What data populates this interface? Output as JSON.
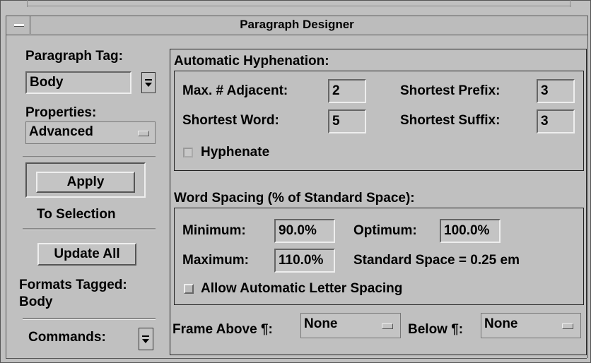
{
  "window": {
    "title": "Paragraph Designer"
  },
  "left_panel": {
    "paragraph_tag_label": "Paragraph Tag:",
    "paragraph_tag_value": "Body",
    "properties_label": "Properties:",
    "properties_value": "Advanced",
    "apply_label": "Apply",
    "to_selection_label": "To Selection",
    "update_all_label": "Update All",
    "formats_tagged_label": "Formats Tagged:",
    "formats_tagged_value": "Body",
    "commands_label": "Commands:"
  },
  "hyphenation": {
    "section_title": "Automatic Hyphenation:",
    "max_adjacent_label": "Max. # Adjacent:",
    "max_adjacent_value": "2",
    "shortest_word_label": "Shortest Word:",
    "shortest_word_value": "5",
    "shortest_prefix_label": "Shortest Prefix:",
    "shortest_prefix_value": "3",
    "shortest_suffix_label": "Shortest Suffix:",
    "shortest_suffix_value": "3",
    "hyphenate_label": "Hyphenate",
    "hyphenate_checked": false
  },
  "word_spacing": {
    "section_title": "Word Spacing (% of Standard Space):",
    "minimum_label": "Minimum:",
    "minimum_value": "90.0%",
    "optimum_label": "Optimum:",
    "optimum_value": "100.0%",
    "maximum_label": "Maximum:",
    "maximum_value": "110.0%",
    "standard_space_text": "Standard Space = 0.25 em",
    "allow_letter_spacing_label": "Allow Automatic Letter Spacing",
    "allow_letter_spacing_checked": false
  },
  "frames": {
    "frame_above_label": "Frame Above ¶:",
    "frame_above_value": "None",
    "below_label": "Below ¶:",
    "below_value": "None"
  },
  "colors": {
    "background": "#c0c0c0",
    "border": "#555555"
  }
}
